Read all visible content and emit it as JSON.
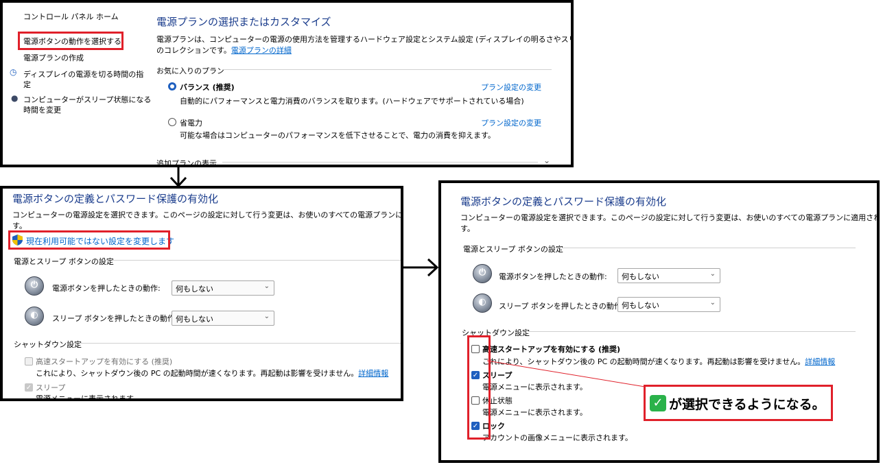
{
  "panel1": {
    "sidebar": [
      "コントロール パネル ホーム",
      "電源ボタンの動作を選択する",
      "電源プランの作成",
      "ディスプレイの電源を切る時間の指",
      "定",
      "コンピューターがスリープ状態になる",
      "時間を変更"
    ],
    "title": "電源プランの選択またはカスタマイズ",
    "desc1": "電源プランは、コンピューターの電源の使用方法を管理するハードウェア設定とシステム設定 (ディスプレイの明るさやスリープなど)",
    "desc2": "のコレクションです。",
    "desc_link": "電源プランの詳細",
    "favorites_header": "お気に入りのプラン",
    "plan_balanced": "バランス (推奨)",
    "plan_balanced_desc": "自動的にパフォーマンスと電力消費のバランスを取ります。(ハードウェアでサポートされている場合)",
    "plan_saver": "省電力",
    "plan_saver_desc": "可能な場合はコンピューターのパフォーマンスを低下させることで、電力の消費を抑えます。",
    "change_plan": "プラン設定の変更",
    "more_plans": "追加プランの表示"
  },
  "panel2": {
    "title": "電源ボタンの定義とパスワード保護の有効化",
    "desc1": "コンピューターの電源設定を選択できます。このページの設定に対して行う変更は、お使いのすべての電源プランに適用されま",
    "desc2": "す。",
    "shield_link": "現在利用可能ではない設定を変更します",
    "power_sleep_header": "電源とスリープ ボタンの設定",
    "power_button_label": "電源ボタンを押したときの動作:",
    "sleep_button_label": "スリープ ボタンを押したときの動作:",
    "select_value": "何もしない",
    "shutdown_header": "シャットダウン設定",
    "fast_startup": "高速スタートアップを有効にする (推奨)",
    "fast_startup_desc": "これにより、シャットダウン後の PC の起動時間が速くなります。再起動は影響を受けません。",
    "details_link": "詳細情報",
    "sleep": "スリープ",
    "sleep_desc": "電源メニューに表示されます。"
  },
  "panel3": {
    "title": "電源ボタンの定義とパスワード保護の有効化",
    "desc1": "コンピューターの電源設定を選択できます。このページの設定に対して行う変更は、お使いのすべての電源プランに適用されま",
    "desc2": "す。",
    "power_sleep_header": "電源とスリープ ボタンの設定",
    "power_button_label": "電源ボタンを押したときの動作:",
    "sleep_button_label": "スリープ ボタンを押したときの動作:",
    "select_value": "何もしない",
    "shutdown_header": "シャットダウン設定",
    "fast_startup": "高速スタートアップを有効にする (推奨)",
    "fast_startup_desc": "これにより、シャットダウン後の PC の起動時間が速くなります。再起動は影響を受けません。",
    "details_link": "詳細情報",
    "sleep": "スリープ",
    "sleep_desc": "電源メニューに表示されます。",
    "hibernate": "休止状態",
    "hibernate_desc": "電源メニューに表示されます。",
    "lock": "ロック",
    "lock_desc": "アカウントの画像メニューに表示されます。"
  },
  "callout": "が選択できるようになる。",
  "colors": {
    "accent_red": "#e0202a",
    "title_blue": "#1a3c8c",
    "link_blue": "#0066cc",
    "check_green": "#2ab24a"
  },
  "states": {
    "panel3": {
      "fast_startup": false,
      "sleep": true,
      "hibernate": false,
      "lock": true
    },
    "panel2": {
      "fast_startup": false,
      "sleep": true
    }
  }
}
